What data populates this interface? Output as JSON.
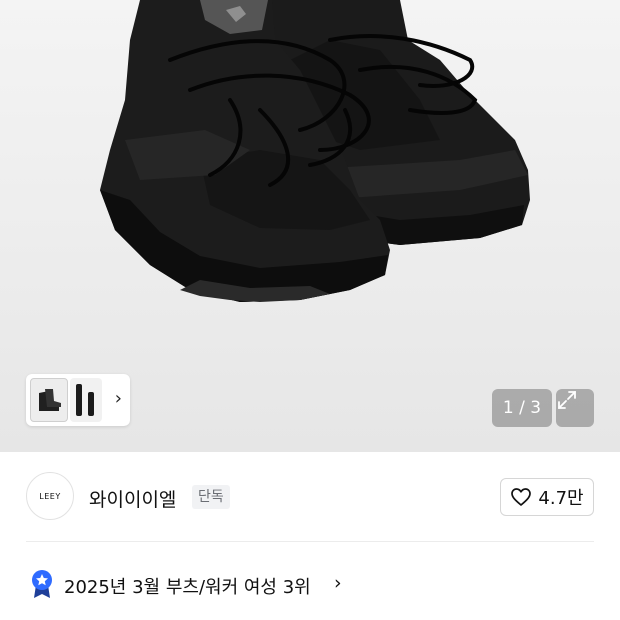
{
  "gallery": {
    "counter": "1 / 3",
    "main_image_icon": "boot-photo",
    "expand_icon": "expand-arrows-icon",
    "thumbnails_more_icon": "chevron-right-icon"
  },
  "store": {
    "logo_text": "LEEY",
    "name": "와이이이엘",
    "badge": "단독",
    "like_count": "4.7만",
    "like_icon": "heart-outline-icon"
  },
  "ranking": {
    "icon": "ribbon-medal-icon",
    "text": "2025년 3월 부츠/워커 여성 3위",
    "chevron": "›",
    "accent_color": "#2f6bff"
  },
  "colors": {
    "hero_background": "#ededed",
    "counter_bg": "#8a8a8a"
  }
}
